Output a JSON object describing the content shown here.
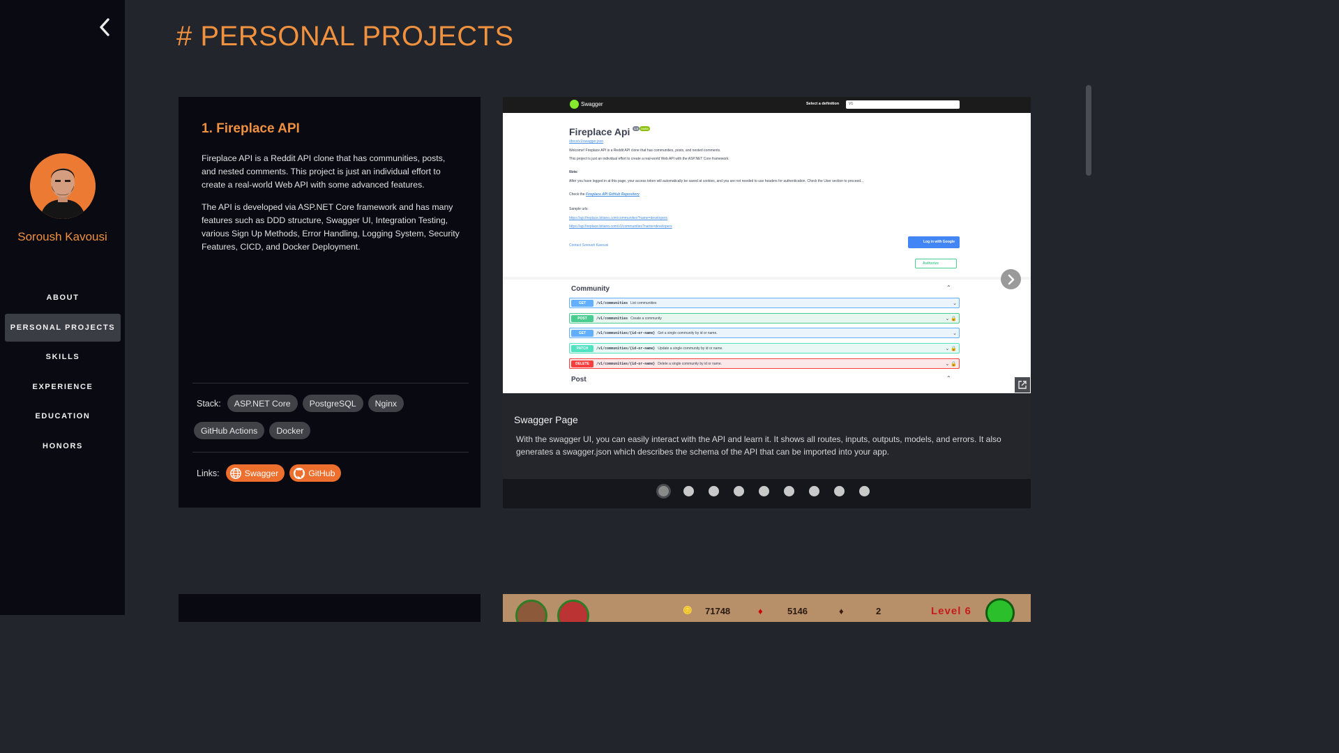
{
  "sidebar": {
    "user_name": "Soroush Kavousi",
    "nav": [
      {
        "label": "ABOUT",
        "active": false
      },
      {
        "label": "PERSONAL PROJECTS",
        "active": true
      },
      {
        "label": "SKILLS",
        "active": false
      },
      {
        "label": "EXPERIENCE",
        "active": false
      },
      {
        "label": "EDUCATION",
        "active": false
      },
      {
        "label": "HONORS",
        "active": false
      }
    ]
  },
  "page": {
    "title": "# PERSONAL PROJECTS"
  },
  "project": {
    "title": "1. Fireplace API",
    "paragraphs": [
      "Fireplace API is a Reddit API clone that has communities, posts, and nested comments. This project is just an individual effort to create a real-world Web API with some advanced features.",
      "The API is developed via ASP.NET Core framework and has many features such as DDD structure, Swagger UI, Integration Testing, various Sign Up Methods, Error Handling, Logging System, Security Features, CICD, and Docker Deployment."
    ],
    "stack_label": "Stack:",
    "stack": [
      "ASP.NET Core",
      "PostgreSQL",
      "Nginx",
      "GitHub Actions",
      "Docker"
    ],
    "links_label": "Links:",
    "links": [
      {
        "label": "Swagger",
        "icon": "globe-icon"
      },
      {
        "label": "GitHub",
        "icon": "github-icon"
      }
    ]
  },
  "carousel": {
    "slide_title": "Swagger Page",
    "slide_text": "With the swagger UI, you can easily interact with the API and learn it. It shows all routes, inputs, outputs, models, and errors. It also generates a swagger.json which describes the schema of the API that can be imported into your app.",
    "dot_count": 9,
    "active_dot": 0,
    "screenshot": {
      "logo": "Swagger",
      "select_label": "Select a definition",
      "select_value": "V1",
      "api_title": "Fireplace Api",
      "badge_version": "1.0",
      "badge_oas": "OAS3",
      "json_link": "/docs/v1/swagger.json",
      "welcome": "Welcome! Fireplace API is a Reddit API clone that has communities, posts, and nested comments.",
      "welcome2": "This project is just an individual effort to create a real-world Web API with the ASP.NET Core framework.",
      "note_label": "Note:",
      "note": "After you have logged in at this page, your access token will automatically be saved at cookies, and you are not needed to use headers for authentication. Check the User section to proceed...",
      "check": "Check the",
      "repo_link": "Fireplace API GitHub Repository",
      "sample_label": "Sample urls:",
      "sample_1": "https://api.fireplace.bitiano.com/communities?name=developers",
      "sample_2": "https://api.fireplace.bitiano.com/v1/communities?name=developers",
      "contact": "Contact Soroush Kavousi",
      "google_btn": "Log in with Google",
      "authorize": "Authorize",
      "section_1": "Community",
      "section_2": "Post",
      "ops": [
        {
          "method": "GET",
          "path": "/v1/communities",
          "desc": "List communities"
        },
        {
          "method": "POST",
          "path": "/v1/communities",
          "desc": "Create a community"
        },
        {
          "method": "GET",
          "path": "/v1/communities/{id-or-name}",
          "desc": "Get a single community by id or name."
        },
        {
          "method": "PATCH",
          "path": "/v1/communities/{id-or-name}",
          "desc": "Update a single community by id or name."
        },
        {
          "method": "DELETE",
          "path": "/v1/communities/{id-or-name}",
          "desc": "Delete a single community by id or name."
        }
      ]
    }
  },
  "next_preview": {
    "score": "71748",
    "gems": "5146",
    "count": "2",
    "level": "Level 6"
  },
  "colors": {
    "accent": "#f0913f",
    "button": "#ec6f2d",
    "sidebar": "#0a0a12",
    "background": "#22252b"
  }
}
